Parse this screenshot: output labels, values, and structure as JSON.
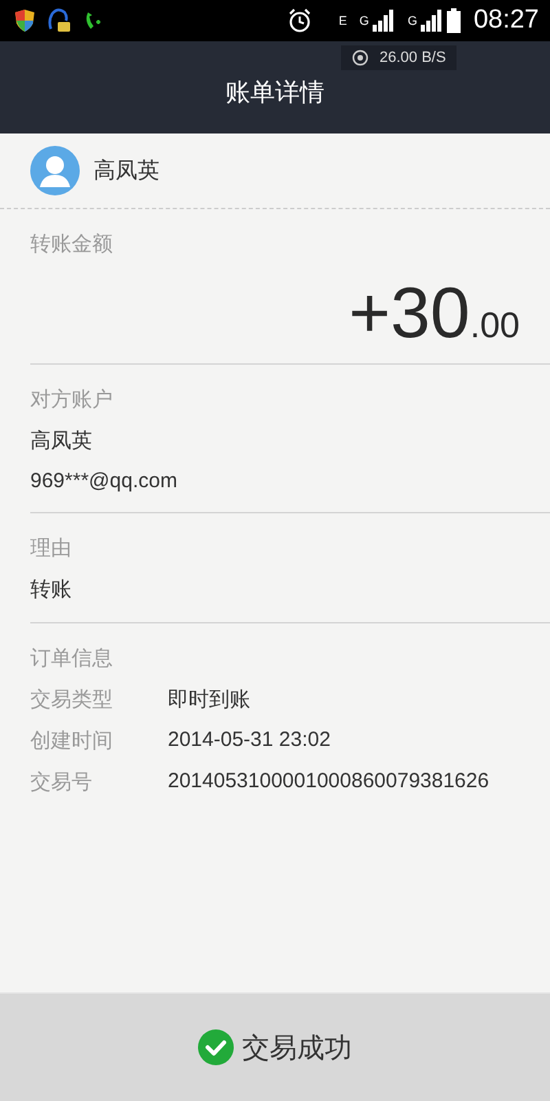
{
  "status_bar": {
    "time": "08:27",
    "networks": [
      "E",
      "G",
      "G"
    ]
  },
  "speed_indicator": "26.00 B/S",
  "header": {
    "title": "账单详情"
  },
  "contact": {
    "name": "高凤英"
  },
  "amount": {
    "label": "转账金额",
    "integer": "+30",
    "decimal": ".00"
  },
  "counterparty": {
    "label": "对方账户",
    "name": "高凤英",
    "account": "969***@qq.com"
  },
  "reason": {
    "label": "理由",
    "value": "转账"
  },
  "order": {
    "label": "订单信息",
    "rows": [
      {
        "key": "交易类型",
        "value": "即时到账"
      },
      {
        "key": "创建时间",
        "value": "2014-05-31 23:02"
      },
      {
        "key": "交易号",
        "value": "2014053100001000860079381626"
      }
    ]
  },
  "status": {
    "text": "交易成功"
  }
}
